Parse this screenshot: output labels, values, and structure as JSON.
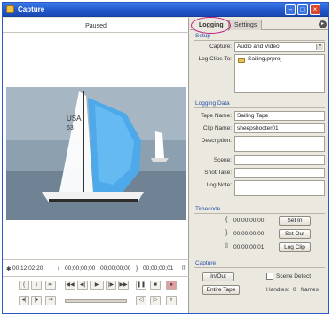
{
  "window": {
    "title": "Capture"
  },
  "monitor": {
    "status": "Paused",
    "timecode_left": "00;12;02;20",
    "timecode_in": "00;00;00;00",
    "timecode_out": "00;00;00;00",
    "timecode_duration": "00;00;00;01"
  },
  "tabs": {
    "logging": "Logging",
    "settings": "Settings"
  },
  "setup": {
    "title": "Setup",
    "capture_label": "Capture:",
    "capture_value": "Audio and Video",
    "log_clips_label": "Log Clips To:",
    "log_clips_value": "Sailing.prproj"
  },
  "clip_data": {
    "title": "Logging Data",
    "tape_name_label": "Tape Name:",
    "tape_name_value": "Sailing Tape",
    "clip_name_label": "Clip Name:",
    "clip_name_value": "sheepshooter01",
    "description_label": "Description:",
    "scene_label": "Scene:",
    "shot_label": "Shot/Take:",
    "log_note_label": "Log Note:"
  },
  "timecode": {
    "title": "Timecode",
    "in_value": "00;00;00;00",
    "out_value": "00;00;00;00",
    "duration_value": "00;00;00;01",
    "set_in": "Set In",
    "set_out": "Set Out",
    "log_clip": "Log Clip"
  },
  "capture": {
    "title": "Capture",
    "in_out": "In/Out",
    "entire_tape": "Entire Tape",
    "scene_detect": "Scene Detect",
    "handles_label": "Handles:",
    "handles_value": "0",
    "frames_label": "frames"
  }
}
